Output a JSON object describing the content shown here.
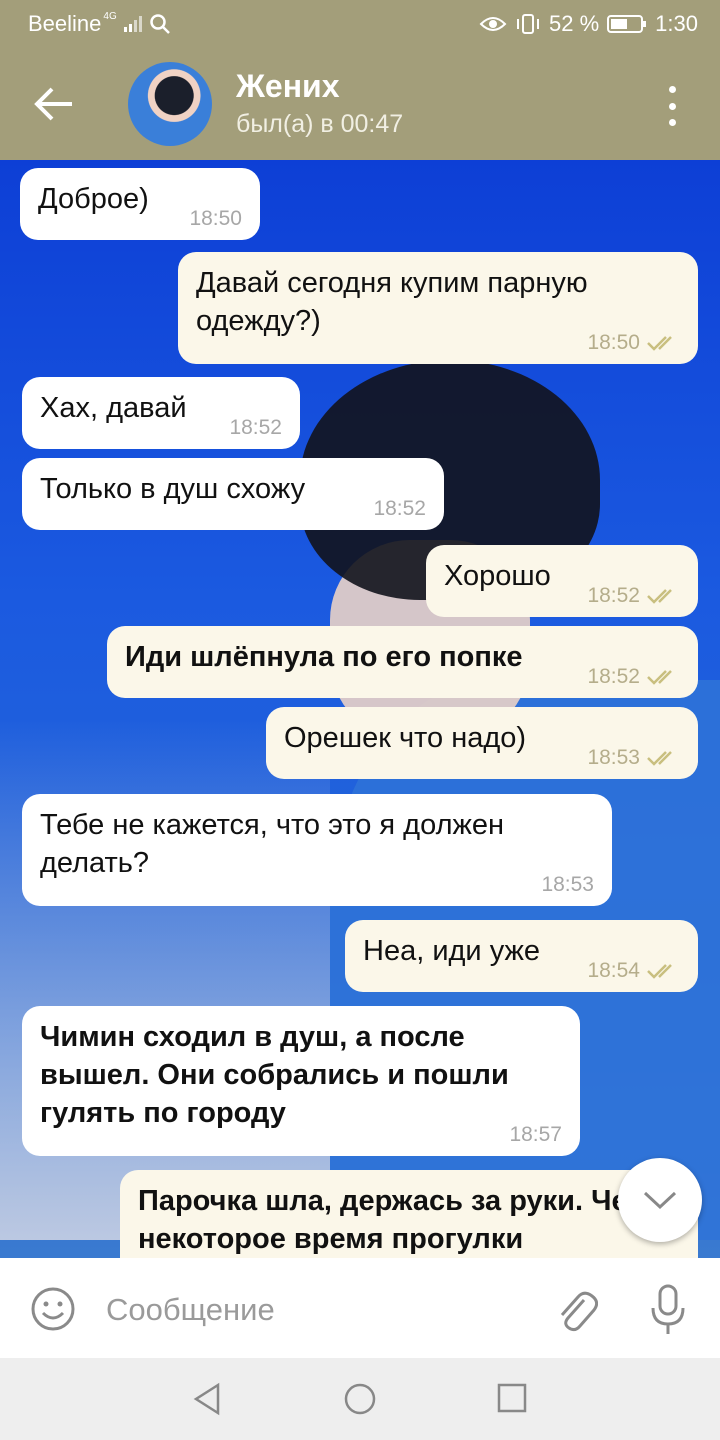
{
  "status_bar": {
    "carrier": "Beeline",
    "network": "4G",
    "battery": "52 %",
    "time": "1:30"
  },
  "header": {
    "title": "Жених",
    "subtitle": "был(а) в 00:47",
    "back_icon": "arrow-left-icon",
    "menu_icon": "more-vert-icon",
    "color": "#a39e7a"
  },
  "messages": [
    {
      "dir": "in",
      "text": "Доброе)",
      "time": "18:50",
      "bold": false
    },
    {
      "dir": "out",
      "text": "Давай сегодня купим парную одежду?)",
      "time": "18:50",
      "bold": false
    },
    {
      "dir": "in",
      "text": "Хах, давай",
      "time": "18:52",
      "bold": false
    },
    {
      "dir": "in",
      "text": "Только в душ схожу",
      "time": "18:52",
      "bold": false
    },
    {
      "dir": "out",
      "text": "Хорошо",
      "time": "18:52",
      "bold": false
    },
    {
      "dir": "out",
      "text": "Иди шлёпнула по его попке",
      "time": "18:52",
      "bold": true
    },
    {
      "dir": "out",
      "text": "Орешек что надо)",
      "time": "18:53",
      "bold": false
    },
    {
      "dir": "in",
      "text": "Тебе не кажется, что это я должен делать?",
      "time": "18:53",
      "bold": false
    },
    {
      "dir": "out",
      "text": "Неа, иди уже",
      "time": "18:54",
      "bold": false
    },
    {
      "dir": "in",
      "text": "Чимин сходил в душ, а после вышел. Они собрались и пошли гулять по городу",
      "time": "18:57",
      "bold": true
    },
    {
      "dir": "out",
      "text": "Парочка шла, держась за руки. Через некоторое время прогулки",
      "time": "",
      "bold": true
    }
  ],
  "input": {
    "placeholder": "Сообщение",
    "emoji_icon": "smile-icon",
    "attach_icon": "paperclip-icon",
    "mic_icon": "microphone-icon"
  },
  "colors": {
    "incoming_bubble": "#ffffff",
    "outgoing_bubble": "#fbf7e9",
    "read_check": "#c9bf7f"
  }
}
